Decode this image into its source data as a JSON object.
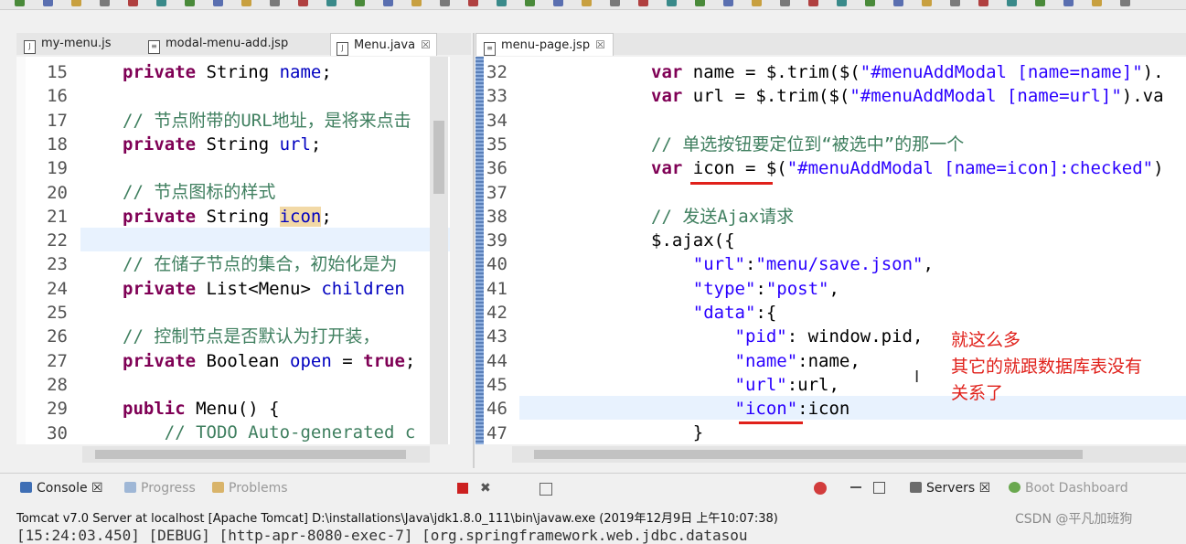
{
  "toolbar": {
    "icon_count": 40
  },
  "left_editor": {
    "tabs": [
      {
        "label": "my-menu.js",
        "icon": "js-file-icon",
        "active": false
      },
      {
        "label": "modal-menu-add.jsp",
        "icon": "jsp-file-icon",
        "active": false
      },
      {
        "label": "Menu.java",
        "icon": "java-file-icon",
        "active": true,
        "close": "☒"
      }
    ],
    "line_numbers": [
      "15",
      "16",
      "17",
      "18",
      "19",
      "20",
      "21",
      "22",
      "23",
      "24",
      "25",
      "26",
      "27",
      "28",
      "29",
      "30"
    ],
    "lines": [
      {
        "tokens": [
          {
            "t": "private",
            "k": "kw"
          },
          {
            "t": " String "
          },
          {
            "t": "name",
            "k": "fld"
          },
          {
            "t": ";"
          }
        ]
      },
      {
        "tokens": []
      },
      {
        "tokens": [
          {
            "t": "// 节点附带的URL地址，是将来点击",
            "k": "cm"
          }
        ]
      },
      {
        "tokens": [
          {
            "t": "private",
            "k": "kw"
          },
          {
            "t": " String "
          },
          {
            "t": "url",
            "k": "fld"
          },
          {
            "t": ";"
          }
        ]
      },
      {
        "tokens": []
      },
      {
        "tokens": [
          {
            "t": "// 节点图标的样式",
            "k": "cm"
          }
        ]
      },
      {
        "tokens": [
          {
            "t": "private",
            "k": "kw"
          },
          {
            "t": " String "
          },
          {
            "t": "icon",
            "k": "fld hl"
          },
          {
            "t": ";"
          }
        ]
      },
      {
        "tokens": [
          {
            "t": "|"
          }
        ]
      },
      {
        "tokens": [
          {
            "t": "// 在储子节点的集合，初始化是为",
            "k": "cm"
          }
        ]
      },
      {
        "tokens": [
          {
            "t": "private",
            "k": "kw"
          },
          {
            "t": " List<Menu> "
          },
          {
            "t": "children",
            "k": "fld"
          }
        ]
      },
      {
        "tokens": []
      },
      {
        "tokens": [
          {
            "t": "// 控制节点是否默认为打开装，",
            "k": "cm"
          }
        ]
      },
      {
        "tokens": [
          {
            "t": "private",
            "k": "kw"
          },
          {
            "t": " Boolean "
          },
          {
            "t": "open",
            "k": "fld"
          },
          {
            "t": " = "
          },
          {
            "t": "true",
            "k": "kw"
          },
          {
            "t": ";"
          }
        ]
      },
      {
        "tokens": []
      },
      {
        "tokens": [
          {
            "t": "public",
            "k": "kw"
          },
          {
            "t": " Menu() {"
          }
        ]
      },
      {
        "tokens": [
          {
            "t": "    // TODO Auto-generated c",
            "k": "cm"
          }
        ]
      }
    ]
  },
  "right_editor": {
    "tabs": [
      {
        "label": "menu-page.jsp",
        "icon": "jsp-file-icon",
        "close": "☒"
      }
    ],
    "line_numbers": [
      "32",
      "33",
      "34",
      "35",
      "36",
      "37",
      "38",
      "39",
      "40",
      "41",
      "42",
      "43",
      "44",
      "45",
      "46",
      "47"
    ],
    "lines": [
      {
        "tokens": [
          {
            "t": "var",
            "k": "kw"
          },
          {
            "t": " name = $.trim($("
          },
          {
            "t": "\"#menuAddModal [name=name]\"",
            "k": "str"
          },
          {
            "t": ")."
          }
        ]
      },
      {
        "tokens": [
          {
            "t": "var",
            "k": "kw"
          },
          {
            "t": " url = $.trim($("
          },
          {
            "t": "\"#menuAddModal [name=url]\"",
            "k": "str"
          },
          {
            "t": ").va"
          }
        ]
      },
      {
        "tokens": []
      },
      {
        "tokens": [
          {
            "t": "// 单选按钮要定位到“被选中”的那一个",
            "k": "cm"
          }
        ]
      },
      {
        "tokens": [
          {
            "t": "var",
            "k": "kw"
          },
          {
            "t": " icon = $("
          },
          {
            "t": "\"#menuAddModal [name=icon]:checked\"",
            "k": "str"
          },
          {
            "t": ")"
          }
        ]
      },
      {
        "tokens": []
      },
      {
        "tokens": [
          {
            "t": "// 发送Ajax请求",
            "k": "cm"
          }
        ]
      },
      {
        "tokens": [
          {
            "t": "$.ajax({"
          }
        ]
      },
      {
        "tokens": [
          {
            "t": "    "
          },
          {
            "t": "\"url\"",
            "k": "str"
          },
          {
            "t": ":"
          },
          {
            "t": "\"menu/save.json\"",
            "k": "str"
          },
          {
            "t": ","
          }
        ]
      },
      {
        "tokens": [
          {
            "t": "    "
          },
          {
            "t": "\"type\"",
            "k": "str"
          },
          {
            "t": ":"
          },
          {
            "t": "\"post\"",
            "k": "str"
          },
          {
            "t": ","
          }
        ]
      },
      {
        "tokens": [
          {
            "t": "    "
          },
          {
            "t": "\"data\"",
            "k": "str"
          },
          {
            "t": ":{"
          }
        ]
      },
      {
        "tokens": [
          {
            "t": "        "
          },
          {
            "t": "\"pid\"",
            "k": "str"
          },
          {
            "t": ": window.pid,"
          }
        ]
      },
      {
        "tokens": [
          {
            "t": "        "
          },
          {
            "t": "\"name\"",
            "k": "str"
          },
          {
            "t": ":name,"
          }
        ]
      },
      {
        "tokens": [
          {
            "t": "        "
          },
          {
            "t": "\"url\"",
            "k": "str"
          },
          {
            "t": ":url,"
          }
        ]
      },
      {
        "tokens": [
          {
            "t": "        "
          },
          {
            "t": "\"icon\"",
            "k": "str"
          },
          {
            "t": ":icon"
          }
        ]
      },
      {
        "tokens": [
          {
            "t": "    }"
          }
        ]
      }
    ]
  },
  "annotation": {
    "lines": [
      "就这么多",
      "其它的就跟数据库表没有",
      "关系了"
    ],
    "color": "#e0201a"
  },
  "bottom_panel": {
    "tabs": [
      {
        "label": "Console",
        "close": "☒",
        "icon": "console-icon"
      },
      {
        "label": "Progress",
        "icon": "progress-icon",
        "dim": true
      },
      {
        "label": "Problems",
        "icon": "problems-icon",
        "dim": true
      }
    ],
    "server_tabs": [
      {
        "label": "Servers",
        "close": "☒",
        "icon": "servers-icon"
      },
      {
        "label": "Boot Dashboard",
        "icon": "boot-dashboard-icon",
        "dim": true
      }
    ],
    "console_title": "Tomcat v7.0 Server at localhost [Apache Tomcat] D:\\installations\\Java\\jdk1.8.0_111\\bin\\javaw.exe (2019年12月9日 上午10:07:38)",
    "console_line": "[15:24:03.450] [DEBUG] [http-apr-8080-exec-7] [org.springframework.web.jdbc.datasou",
    "watermark": "CSDN @平凡加班狗"
  },
  "colors": {
    "keyword": "#7f0055",
    "comment": "#3f7f5f",
    "field": "#0000c0",
    "string": "#2a00ff",
    "accent_underline": "#e0201a"
  }
}
